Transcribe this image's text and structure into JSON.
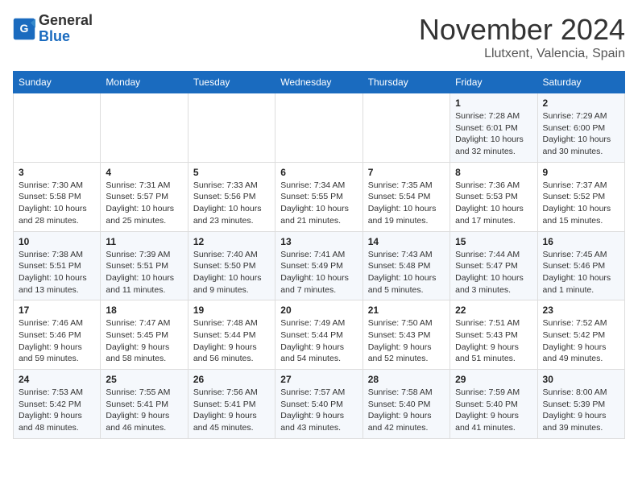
{
  "header": {
    "logo_line1": "General",
    "logo_line2": "Blue",
    "month_title": "November 2024",
    "location": "Llutxent, Valencia, Spain"
  },
  "weekdays": [
    "Sunday",
    "Monday",
    "Tuesday",
    "Wednesday",
    "Thursday",
    "Friday",
    "Saturday"
  ],
  "weeks": [
    [
      {
        "day": "",
        "info": ""
      },
      {
        "day": "",
        "info": ""
      },
      {
        "day": "",
        "info": ""
      },
      {
        "day": "",
        "info": ""
      },
      {
        "day": "",
        "info": ""
      },
      {
        "day": "1",
        "info": "Sunrise: 7:28 AM\nSunset: 6:01 PM\nDaylight: 10 hours\nand 32 minutes."
      },
      {
        "day": "2",
        "info": "Sunrise: 7:29 AM\nSunset: 6:00 PM\nDaylight: 10 hours\nand 30 minutes."
      }
    ],
    [
      {
        "day": "3",
        "info": "Sunrise: 7:30 AM\nSunset: 5:58 PM\nDaylight: 10 hours\nand 28 minutes."
      },
      {
        "day": "4",
        "info": "Sunrise: 7:31 AM\nSunset: 5:57 PM\nDaylight: 10 hours\nand 25 minutes."
      },
      {
        "day": "5",
        "info": "Sunrise: 7:33 AM\nSunset: 5:56 PM\nDaylight: 10 hours\nand 23 minutes."
      },
      {
        "day": "6",
        "info": "Sunrise: 7:34 AM\nSunset: 5:55 PM\nDaylight: 10 hours\nand 21 minutes."
      },
      {
        "day": "7",
        "info": "Sunrise: 7:35 AM\nSunset: 5:54 PM\nDaylight: 10 hours\nand 19 minutes."
      },
      {
        "day": "8",
        "info": "Sunrise: 7:36 AM\nSunset: 5:53 PM\nDaylight: 10 hours\nand 17 minutes."
      },
      {
        "day": "9",
        "info": "Sunrise: 7:37 AM\nSunset: 5:52 PM\nDaylight: 10 hours\nand 15 minutes."
      }
    ],
    [
      {
        "day": "10",
        "info": "Sunrise: 7:38 AM\nSunset: 5:51 PM\nDaylight: 10 hours\nand 13 minutes."
      },
      {
        "day": "11",
        "info": "Sunrise: 7:39 AM\nSunset: 5:51 PM\nDaylight: 10 hours\nand 11 minutes."
      },
      {
        "day": "12",
        "info": "Sunrise: 7:40 AM\nSunset: 5:50 PM\nDaylight: 10 hours\nand 9 minutes."
      },
      {
        "day": "13",
        "info": "Sunrise: 7:41 AM\nSunset: 5:49 PM\nDaylight: 10 hours\nand 7 minutes."
      },
      {
        "day": "14",
        "info": "Sunrise: 7:43 AM\nSunset: 5:48 PM\nDaylight: 10 hours\nand 5 minutes."
      },
      {
        "day": "15",
        "info": "Sunrise: 7:44 AM\nSunset: 5:47 PM\nDaylight: 10 hours\nand 3 minutes."
      },
      {
        "day": "16",
        "info": "Sunrise: 7:45 AM\nSunset: 5:46 PM\nDaylight: 10 hours\nand 1 minute."
      }
    ],
    [
      {
        "day": "17",
        "info": "Sunrise: 7:46 AM\nSunset: 5:46 PM\nDaylight: 9 hours\nand 59 minutes."
      },
      {
        "day": "18",
        "info": "Sunrise: 7:47 AM\nSunset: 5:45 PM\nDaylight: 9 hours\nand 58 minutes."
      },
      {
        "day": "19",
        "info": "Sunrise: 7:48 AM\nSunset: 5:44 PM\nDaylight: 9 hours\nand 56 minutes."
      },
      {
        "day": "20",
        "info": "Sunrise: 7:49 AM\nSunset: 5:44 PM\nDaylight: 9 hours\nand 54 minutes."
      },
      {
        "day": "21",
        "info": "Sunrise: 7:50 AM\nSunset: 5:43 PM\nDaylight: 9 hours\nand 52 minutes."
      },
      {
        "day": "22",
        "info": "Sunrise: 7:51 AM\nSunset: 5:43 PM\nDaylight: 9 hours\nand 51 minutes."
      },
      {
        "day": "23",
        "info": "Sunrise: 7:52 AM\nSunset: 5:42 PM\nDaylight: 9 hours\nand 49 minutes."
      }
    ],
    [
      {
        "day": "24",
        "info": "Sunrise: 7:53 AM\nSunset: 5:42 PM\nDaylight: 9 hours\nand 48 minutes."
      },
      {
        "day": "25",
        "info": "Sunrise: 7:55 AM\nSunset: 5:41 PM\nDaylight: 9 hours\nand 46 minutes."
      },
      {
        "day": "26",
        "info": "Sunrise: 7:56 AM\nSunset: 5:41 PM\nDaylight: 9 hours\nand 45 minutes."
      },
      {
        "day": "27",
        "info": "Sunrise: 7:57 AM\nSunset: 5:40 PM\nDaylight: 9 hours\nand 43 minutes."
      },
      {
        "day": "28",
        "info": "Sunrise: 7:58 AM\nSunset: 5:40 PM\nDaylight: 9 hours\nand 42 minutes."
      },
      {
        "day": "29",
        "info": "Sunrise: 7:59 AM\nSunset: 5:40 PM\nDaylight: 9 hours\nand 41 minutes."
      },
      {
        "day": "30",
        "info": "Sunrise: 8:00 AM\nSunset: 5:39 PM\nDaylight: 9 hours\nand 39 minutes."
      }
    ]
  ]
}
